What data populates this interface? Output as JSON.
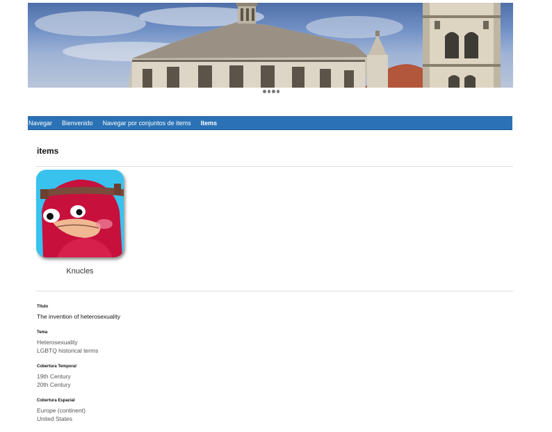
{
  "navbar": {
    "links": [
      {
        "label": "Navegar"
      },
      {
        "label": "Bienvenido"
      },
      {
        "label": "Navegar por conjuntos de items"
      },
      {
        "label": "Items"
      }
    ]
  },
  "main": {
    "title": "items",
    "items": [
      {
        "caption": "Knucles"
      }
    ]
  },
  "metadata": [
    {
      "label": "Titulo",
      "values": [
        "The invention of heterosexuality"
      ]
    },
    {
      "label": "Tema",
      "values": [
        "Heterosexuality",
        "LGBTQ historical terms"
      ]
    },
    {
      "label": "Cobertura Temporal",
      "values": [
        "19th Century",
        "20th Century"
      ]
    },
    {
      "label": "Cobertura Espacial",
      "values": [
        "Europe (continent)",
        "United States"
      ]
    }
  ],
  "colors": {
    "navbar": "#2a72b5",
    "nav_text": "#ffffff"
  }
}
